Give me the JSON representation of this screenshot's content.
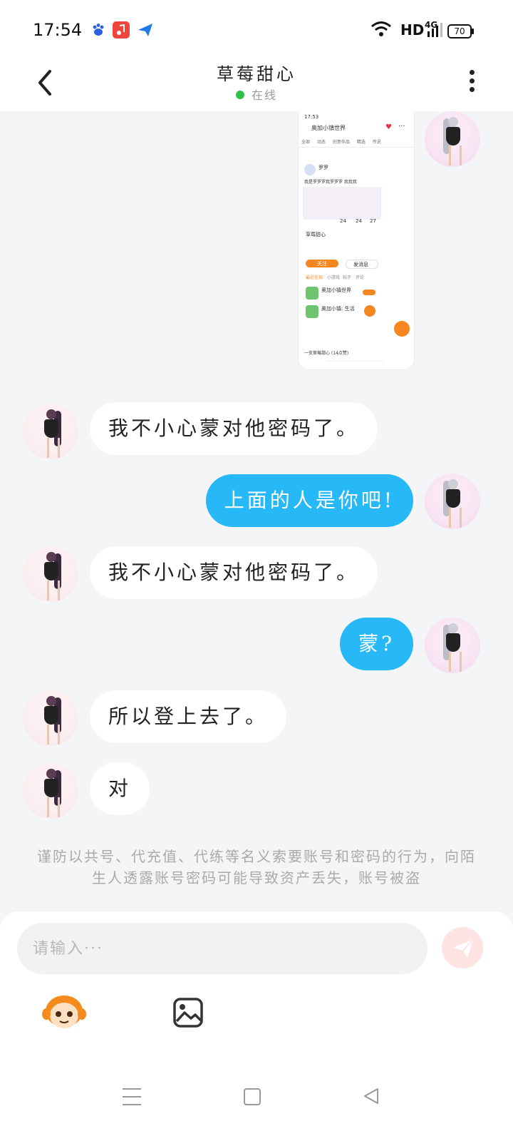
{
  "status_bar": {
    "time": "17:54",
    "network": "HD",
    "signal": "4G",
    "battery": "70",
    "notification_icons": [
      "baidu-icon",
      "music-icon",
      "send-icon"
    ]
  },
  "header": {
    "back_icon": "chevron-left-icon",
    "title": "草莓甜心",
    "status": "在线",
    "more_icon": "more-vertical-icon"
  },
  "messages": [
    {
      "side": "out",
      "type": "image",
      "content": "screenshot"
    },
    {
      "side": "in",
      "type": "text",
      "text": "我不小心蒙对他密码了。"
    },
    {
      "side": "out",
      "type": "text",
      "text": "上面的人是你吧!"
    },
    {
      "side": "in",
      "type": "text",
      "text": "我不小心蒙对他密码了。"
    },
    {
      "side": "out",
      "type": "text",
      "text": "蒙?"
    },
    {
      "side": "in",
      "type": "text",
      "text": "所以登上去了。"
    },
    {
      "side": "in",
      "type": "text",
      "text": "对"
    }
  ],
  "image_message": {
    "header_title": "奥加小镇世界",
    "tabs": [
      "全部",
      "全部",
      "动态",
      "创意作品",
      "精选",
      "传说"
    ],
    "user_name": "罗罗",
    "bio": "我是罗罗罗我罗罗罗 我我我",
    "stats": [
      "24",
      "24",
      "27"
    ],
    "profile_name": "草莓甜心",
    "follow_label": "关注",
    "message_label": "发消息",
    "section_tabs": [
      "最近在玩",
      "小游戏",
      "帖子",
      "评论"
    ],
    "games": [
      "奥加小镇世界",
      "奥加小镇: 生活"
    ],
    "footer": "一支草莓甜心 (14点赞)"
  },
  "warning": "谨防以共号、代充值、代练等名义索要账号和密码的行为，向陌生人透露账号密码可能导致资产丢失，账号被盗",
  "input": {
    "placeholder": "请输入···",
    "send_icon": "send-icon",
    "emoji_icon": "monkey-emoji-icon",
    "image_icon": "image-icon"
  },
  "colors": {
    "outgoing_bubble": "#27b8f7",
    "incoming_bubble": "#ffffff",
    "online": "#2ec24b",
    "background": "#f4f5f7"
  }
}
